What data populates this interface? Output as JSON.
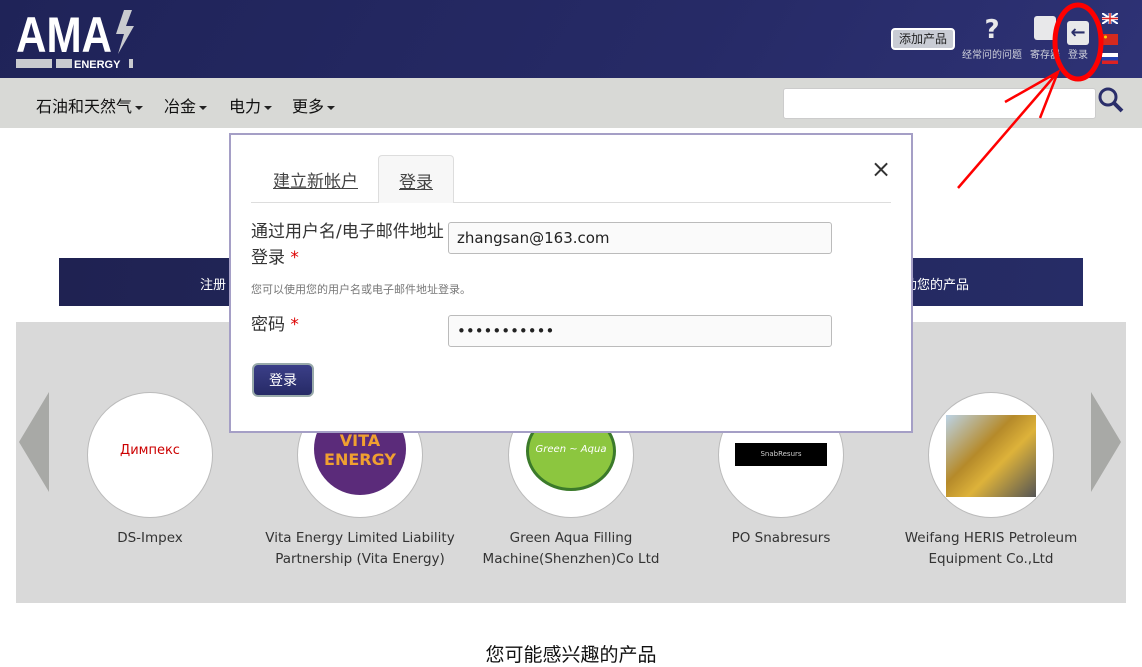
{
  "header": {
    "logo_text": "AMA ENERGY",
    "add_product": "添加产品",
    "icons": [
      {
        "label": "经常问的问题",
        "icon": "question-icon"
      },
      {
        "label": "寄存器",
        "icon": "register-icon"
      },
      {
        "label": "登录",
        "icon": "login-icon"
      }
    ],
    "languages": [
      "en",
      "zh",
      "ru"
    ]
  },
  "nav": {
    "items": [
      "石油和天然气",
      "冶金",
      "电力",
      "更多"
    ],
    "search_placeholder": ""
  },
  "banner": {
    "left": "注册",
    "right": "助您的产品"
  },
  "carousel": {
    "companies": [
      "DS-Impex",
      "Vita Energy Limited Liability Partnership (Vita Energy)",
      "Green Aqua Filling Machine(Shenzhen)Co Ltd",
      "PO Snabresurs",
      "Weifang HERIS Petroleum Equipment Co.,Ltd"
    ],
    "logos": [
      "Димпекс",
      "VITA ENERGY",
      "Green ~ Aqua",
      "SnabResurs"
    ]
  },
  "modal": {
    "tabs": [
      "建立新帐户",
      "登录"
    ],
    "active_tab": "登录",
    "username_label": "通过用户名/电子邮件地址登录",
    "username_value": "zhangsan@163.com",
    "hint": "您可以使用您的用户名或电子邮件地址登录。",
    "password_label": "密码",
    "password_value": "•••••••••••",
    "required": "*",
    "submit": "登录",
    "close": "×"
  },
  "bottom_heading": "您可能感兴趣的产品",
  "colors": {
    "header": "#24285e",
    "nav": "#d8d9d6",
    "annotation": "#ff0000"
  }
}
